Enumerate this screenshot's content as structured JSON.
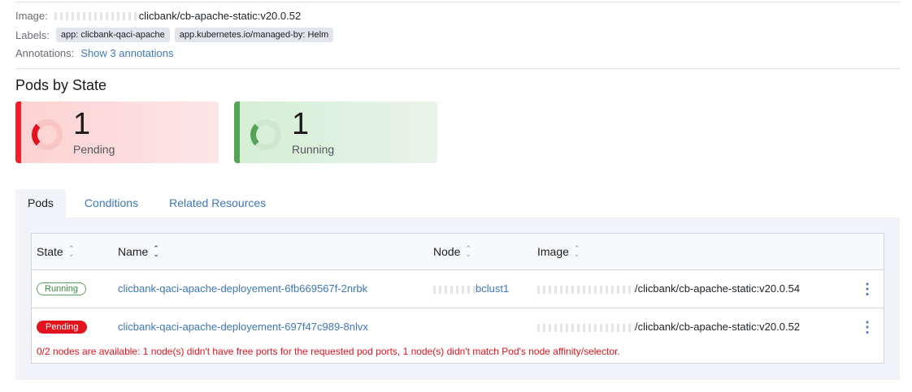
{
  "details": {
    "image_label": "Image:",
    "image_value": "clicbank/cb-apache-static:v20.0.52",
    "labels_label": "Labels:",
    "labels": [
      "app: clicbank-qaci-apache",
      "app.kubernetes.io/managed-by: Helm"
    ],
    "annotations_label": "Annotations:",
    "annotations_link": "Show 3 annotations"
  },
  "pods_by_state": {
    "title": "Pods by State",
    "pending": {
      "count": "1",
      "label": "Pending",
      "color": "#f01f2a"
    },
    "running": {
      "count": "1",
      "label": "Running",
      "color": "#54a557"
    }
  },
  "tabs": [
    "Pods",
    "Conditions",
    "Related Resources"
  ],
  "active_tab": "Pods",
  "table": {
    "headers": [
      "State",
      "Name",
      "Node",
      "Image"
    ],
    "rows": [
      {
        "state": "Running",
        "name": "clicbank-qaci-apache-deployement-6fb669567f-2nrbk",
        "node": "bclust1",
        "image": "/clicbank/cb-apache-static:v20.0.54"
      },
      {
        "state": "Pending",
        "name": "clicbank-qaci-apache-deployement-697f47c989-8nlvx",
        "node": "",
        "image": "/clicbank/cb-apache-static:v20.0.52",
        "error": "0/2 nodes are available: 1 node(s) didn't have free ports for the requested pod ports, 1 node(s) didn't match Pod's node affinity/selector."
      }
    ]
  }
}
